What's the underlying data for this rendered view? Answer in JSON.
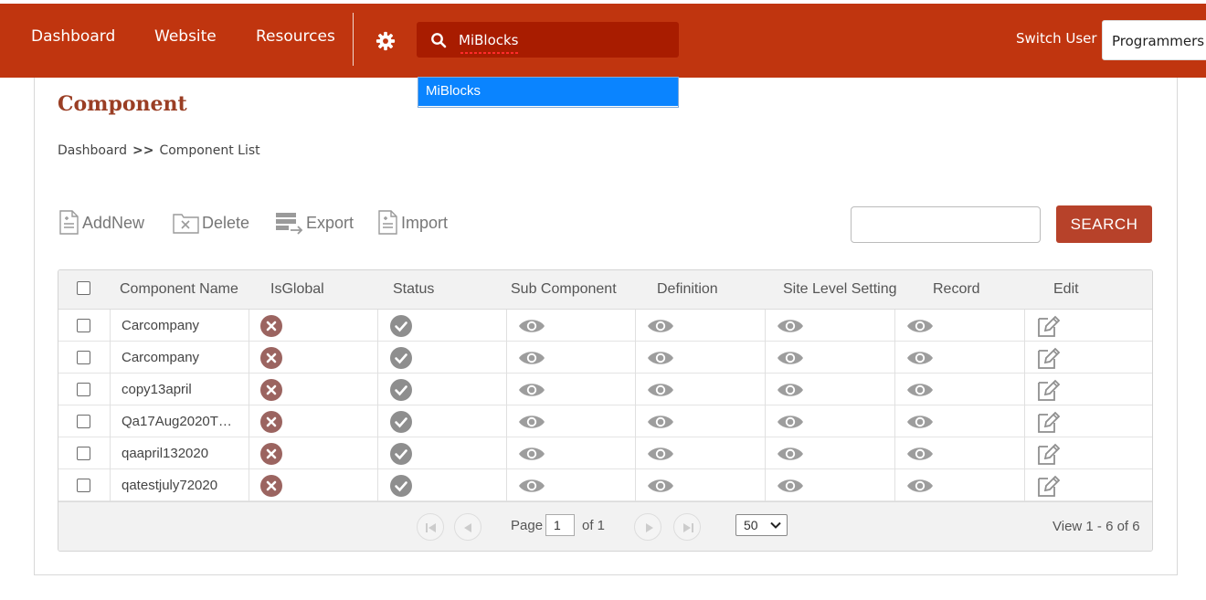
{
  "nav": {
    "items": [
      "Dashboard",
      "Website",
      "Resources"
    ],
    "search_value": "MiBlocks",
    "switch_user_label": "Switch User",
    "user_selected": "Programmers"
  },
  "autocomplete": {
    "options": [
      "MiBlocks"
    ]
  },
  "page": {
    "title": "Component",
    "breadcrumb": {
      "home": "Dashboard",
      "separator": ">>",
      "current": "Component List"
    }
  },
  "toolbar": {
    "add_label": "AddNew",
    "delete_label": "Delete",
    "export_label": "Export",
    "import_label": "Import",
    "search_button": "SEARCH",
    "search_value": ""
  },
  "grid": {
    "columns": [
      "Component Name",
      "IsGlobal",
      "Status",
      "Sub Component",
      "Definition",
      "Site Level Setting",
      "Record",
      "Edit"
    ],
    "rows": [
      {
        "name": "Carcompany",
        "is_global": "no",
        "status": "active"
      },
      {
        "name": "Carcompany",
        "is_global": "no",
        "status": "active"
      },
      {
        "name": "copy13april",
        "is_global": "no",
        "status": "active"
      },
      {
        "name": "Qa17Aug2020T…",
        "is_global": "no",
        "status": "active"
      },
      {
        "name": "qaapril132020",
        "is_global": "no",
        "status": "active"
      },
      {
        "name": "qatestjuly72020",
        "is_global": "no",
        "status": "active"
      }
    ],
    "pager": {
      "page_label": "Page",
      "page_value": "1",
      "of_label": "of 1",
      "page_size": "50",
      "view_text": "View 1 - 6 of 6"
    }
  },
  "colors": {
    "topbar": "#c0350f",
    "search_bg": "#a81c00",
    "title": "#9a3e24",
    "search_button": "#b7422a",
    "highlight": "#0a84ff"
  },
  "icons": {
    "settings": "gear-icon",
    "search": "search-icon",
    "not_global": "x-circle-icon",
    "status_ok": "check-circle-icon",
    "view": "eye-icon",
    "edit": "edit-icon"
  }
}
